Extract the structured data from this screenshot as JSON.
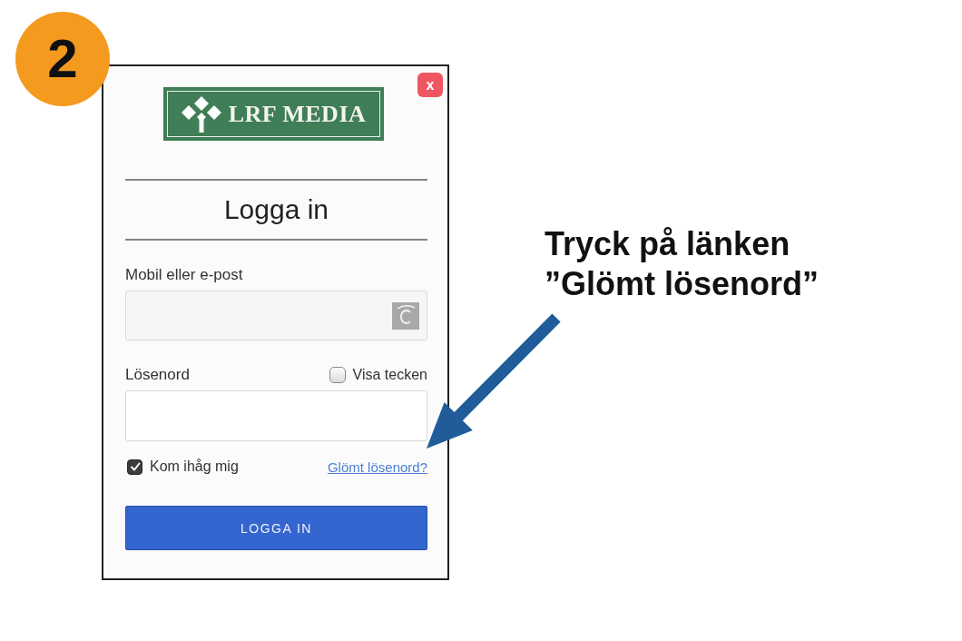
{
  "step_badge": {
    "text": "2"
  },
  "dialog": {
    "close_button": {
      "label": "x"
    },
    "logo": {
      "text": "LRF MEDIA"
    },
    "title": "Logga in",
    "fields": [
      {
        "kind": "text",
        "label": "Mobil eller e-post"
      },
      {
        "kind": "password",
        "label": "Lösenord",
        "toggle": {
          "label": "Visa tecken",
          "checked": false
        }
      }
    ],
    "remember": {
      "label": "Kom ihåg mig",
      "checked": true
    },
    "forgot_link": {
      "label": "Glömt lösenord?"
    },
    "submit_button": {
      "label": "LOGGA IN"
    }
  },
  "annotation": {
    "text": "Tryck på länken ”Glömt lösenord”"
  }
}
